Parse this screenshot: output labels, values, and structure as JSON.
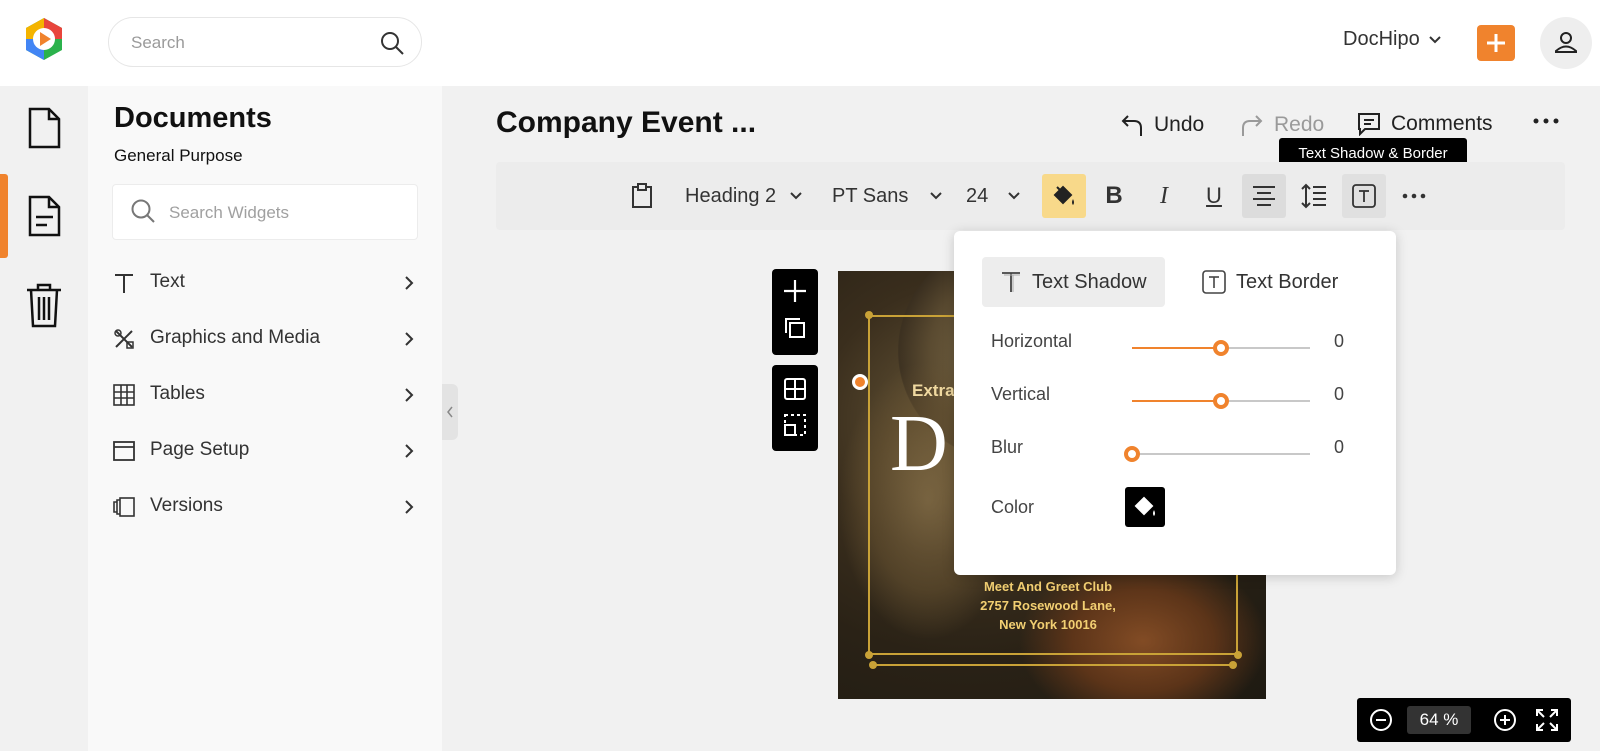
{
  "header": {
    "search_placeholder": "Search",
    "account_name": "DocHipo",
    "brand_color": "#f0832d"
  },
  "rail": {
    "items": [
      {
        "icon": "document-icon"
      },
      {
        "icon": "document-lines-icon",
        "active": true
      },
      {
        "icon": "trash-icon"
      }
    ]
  },
  "sidebar": {
    "title": "Documents",
    "subtitle": "General Purpose",
    "search_placeholder": "Search Widgets",
    "items": [
      {
        "label": "Text",
        "icon": "text-icon"
      },
      {
        "label": "Graphics and Media",
        "icon": "graphics-icon"
      },
      {
        "label": "Tables",
        "icon": "table-icon"
      },
      {
        "label": "Page Setup",
        "icon": "page-setup-icon"
      },
      {
        "label": "Versions",
        "icon": "versions-icon"
      }
    ]
  },
  "main": {
    "doc_title": "Company Event ...",
    "undo_label": "Undo",
    "redo_label": "Redo",
    "comments_label": "Comments"
  },
  "toolbar": {
    "style_value": "Heading 2",
    "font_value": "PT Sans",
    "size_value": "24",
    "tooltip": "Text Shadow & Border"
  },
  "canvas": {
    "extra_text": "Extra",
    "big_letter": "D",
    "address_lines": [
      "Meet And Greet Club",
      "2757 Rosewood Lane,",
      "New York 10016"
    ]
  },
  "popover": {
    "tab_shadow": "Text Shadow",
    "tab_border": "Text Border",
    "horizontal_label": "Horizontal",
    "horizontal_value": "0",
    "horizontal_level": 0.5,
    "vertical_label": "Vertical",
    "vertical_value": "0",
    "vertical_level": 0.5,
    "blur_label": "Blur",
    "blur_value": "0",
    "blur_level": 0,
    "color_label": "Color"
  },
  "zoom": {
    "value": "64",
    "unit": "%"
  }
}
